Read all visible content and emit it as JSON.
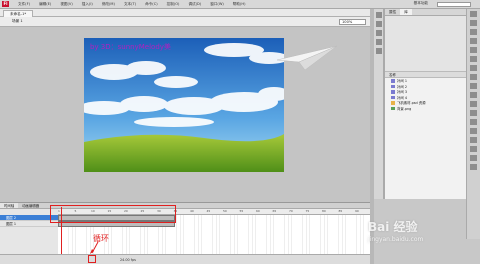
{
  "menubar": {
    "logo": "Fl",
    "items": [
      "文件(F)",
      "编辑(E)",
      "视图(V)",
      "插入(I)",
      "修改(M)",
      "文本(T)",
      "命令(C)",
      "控制(O)",
      "调试(D)",
      "窗口(W)",
      "帮助(H)"
    ],
    "workspace": "基本功能"
  },
  "document": {
    "tab": "未命名-1*",
    "scene": "场景 1",
    "zoom": "100%"
  },
  "stage": {
    "caption": "by 3D：sunnyMelody美"
  },
  "library": {
    "tabs": [
      "属性",
      "库"
    ],
    "header": "名称",
    "items": [
      "补间 1",
      "补间 2",
      "补间 3",
      "补间 4",
      "飞机素材.psd 资源",
      "背景.png"
    ]
  },
  "timeline": {
    "tabs": [
      "时间轴",
      "动画编辑器"
    ],
    "layers": [
      "图层 2",
      "图层 1"
    ],
    "ruler": [
      "1",
      "5",
      "10",
      "15",
      "20",
      "25",
      "30",
      "35",
      "40",
      "45",
      "50",
      "55",
      "60",
      "65",
      "70",
      "75",
      "80",
      "85",
      "90"
    ],
    "fps": "24.00 fps"
  },
  "annotation": {
    "label": "循环"
  },
  "watermark": {
    "text": "Bai 经验",
    "sub": "jingyan.baidu.com"
  }
}
